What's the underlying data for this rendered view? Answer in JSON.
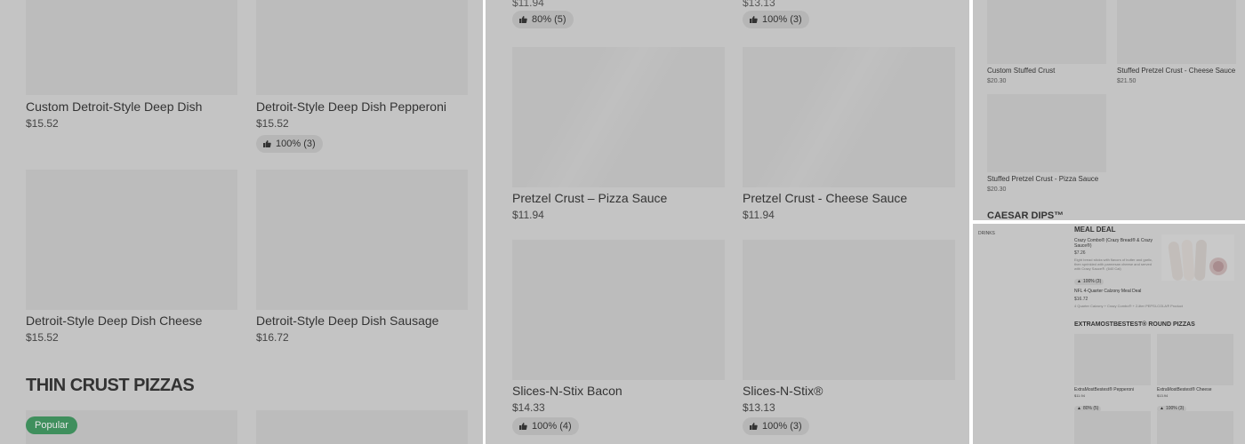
{
  "panel1": {
    "top_cards": [
      {
        "name": "Custom Detroit-Style Deep Dish",
        "price": "$15.52"
      },
      {
        "name": "Detroit-Style Deep Dish Pepperoni",
        "price": "$15.52",
        "rating": "100% (3)"
      }
    ],
    "mid_cards": [
      {
        "name": "Detroit-Style Deep Dish Cheese",
        "price": "$15.52"
      },
      {
        "name": "Detroit-Style Deep Dish Sausage",
        "price": "$16.72"
      }
    ],
    "section_title": "THIN CRUST PIZZAS",
    "badge": "Popular"
  },
  "panel2": {
    "top_ratings": [
      "80% (5)",
      "100% (3)"
    ],
    "cards": [
      {
        "name": "Pretzel Crust – Pizza Sauce",
        "price": "$11.94"
      },
      {
        "name": "Pretzel Crust - Cheese Sauce",
        "price": "$11.94"
      },
      {
        "name": "Slices-N-Stix Bacon",
        "price": "$14.33",
        "rating": "100% (4)"
      },
      {
        "name": "Slices-N-Stix®",
        "price": "$13.13",
        "rating": "100% (3)"
      }
    ]
  },
  "panel3": {
    "cards": [
      {
        "name": "Custom Stuffed Crust",
        "price": "$20.30"
      },
      {
        "name": "Stuffed Pretzel Crust - Cheese Sauce",
        "price": "$21.50"
      },
      {
        "name": "Stuffed Pretzel Crust - Pizza Sauce",
        "price": "$20.30"
      }
    ],
    "section_title": "CAESAR DIPS™"
  },
  "panel4": {
    "sidebar_item": "DRINKS",
    "meal_deal_title": "MEAL DEAL",
    "combo": {
      "name": "Crazy Combo® (Crazy Bread® & Crazy Sauce®)",
      "price": "$7.26",
      "desc": "Eight bread sticks with flavors of butter and garlic, then sprinkled with parmesan cheese and served with Crazy Sauce®. (640 Cal)",
      "rating": "100% (3)"
    },
    "nfl": {
      "name": "NFL 4-Quarter Calzony Meal Deal",
      "price": "$16.72",
      "desc": "4 Quarter Calzony + Crazy Combo® + 2-liter PEPSI-COLA® Product"
    },
    "section_title": "EXTRAMOSTBESTEST® ROUND PIZZAS",
    "cards": [
      {
        "name": "ExtraMostBestest® Pepperoni",
        "price": "$11.94",
        "rating": "80% (5)"
      },
      {
        "name": "ExtraMostBestest® Cheese",
        "price": "$13.94",
        "rating": "100% (3)"
      }
    ]
  }
}
